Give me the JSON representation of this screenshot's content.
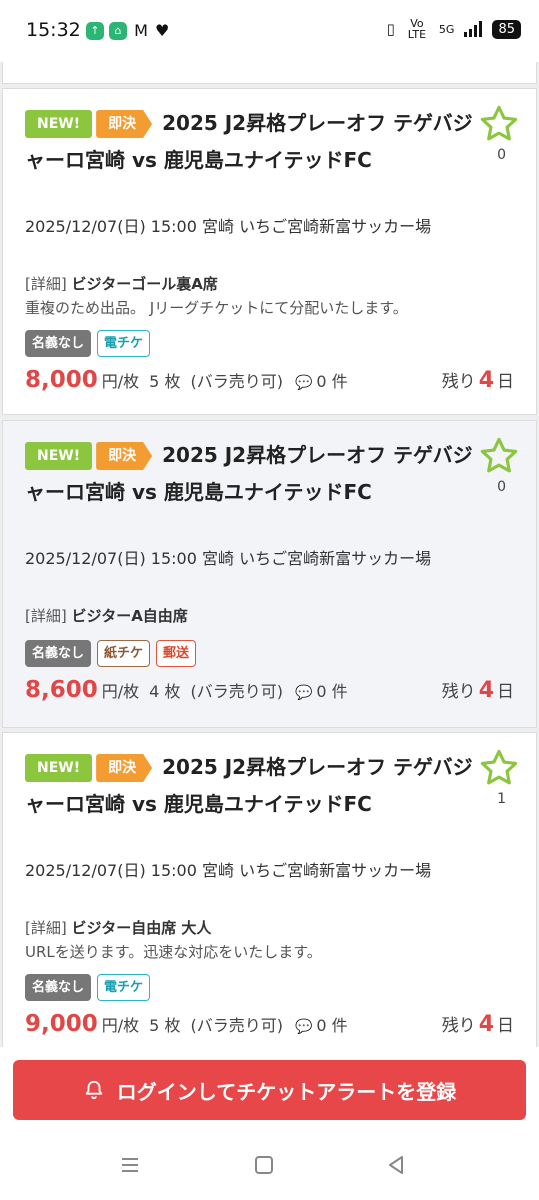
{
  "status_bar": {
    "time": "15:32",
    "volte": "Vo LTE",
    "network": "5G",
    "battery": "85"
  },
  "listings": [
    {
      "badge_new": "NEW!",
      "badge_sokketsu": "即決",
      "title": "2025 J2昇格プレーオフ テゲバジャーロ宮崎 vs 鹿児島ユナイテッドFC",
      "fav_count": "0",
      "datetime": "2025/12/07(日) 15:00 宮崎 いちご宮崎新富サッカー場",
      "detail_prefix": "[詳細]",
      "detail_seat": "ビジターゴール裏A席",
      "note": "重複のため出品。 Jリーグチケットにて分配いたします。",
      "tags": [
        "名義なし",
        "電チケ"
      ],
      "price": "8,000",
      "unit": "円/枚",
      "quantity": "5 枚",
      "bara": "(バラ売り可)",
      "comments": "0 件",
      "remain_label": "残り",
      "remain_num": "4",
      "remain_unit": "日"
    },
    {
      "badge_new": "NEW!",
      "badge_sokketsu": "即決",
      "title": "2025 J2昇格プレーオフ テゲバジャーロ宮崎 vs 鹿児島ユナイテッドFC",
      "fav_count": "0",
      "datetime": "2025/12/07(日) 15:00 宮崎 いちご宮崎新富サッカー場",
      "detail_prefix": "[詳細]",
      "detail_seat": "ビジターA自由席",
      "note": "",
      "tags": [
        "名義なし",
        "紙チケ",
        "郵送"
      ],
      "price": "8,600",
      "unit": "円/枚",
      "quantity": "4 枚",
      "bara": "(バラ売り可)",
      "comments": "0 件",
      "remain_label": "残り",
      "remain_num": "4",
      "remain_unit": "日"
    },
    {
      "badge_new": "NEW!",
      "badge_sokketsu": "即決",
      "title": "2025 J2昇格プレーオフ テゲバジャーロ宮崎 vs 鹿児島ユナイテッドFC",
      "fav_count": "1",
      "datetime": "2025/12/07(日) 15:00 宮崎 いちご宮崎新富サッカー場",
      "detail_prefix": "[詳細]",
      "detail_seat": "ビジター自由席 大人",
      "note": "URLを送ります。迅速な対応をいたします。",
      "tags": [
        "名義なし",
        "電チケ"
      ],
      "price": "9,000",
      "unit": "円/枚",
      "quantity": "5 枚",
      "bara": "(バラ売り可)",
      "comments": "0 件",
      "remain_label": "残り",
      "remain_num": "4",
      "remain_unit": "日"
    }
  ],
  "alert_button": {
    "label": "ログインしてチケットアラートを登録"
  },
  "icons": {
    "favorite": "star-outline-icon",
    "comment": "speech-bubble-icon",
    "bell": "bell-icon",
    "nav_menu": "menu-icon",
    "nav_home": "square-home-icon",
    "nav_back": "triangle-back-icon"
  },
  "colors": {
    "new_badge": "#8cc63f",
    "sokketsu_badge": "#f39c32",
    "price": "#e04848",
    "star": "#8cc63f",
    "alert_button": "#e8474a",
    "e_ticket": "#2bb5c6",
    "paper_ticket": "#9b6b45",
    "post": "#e2553a"
  }
}
